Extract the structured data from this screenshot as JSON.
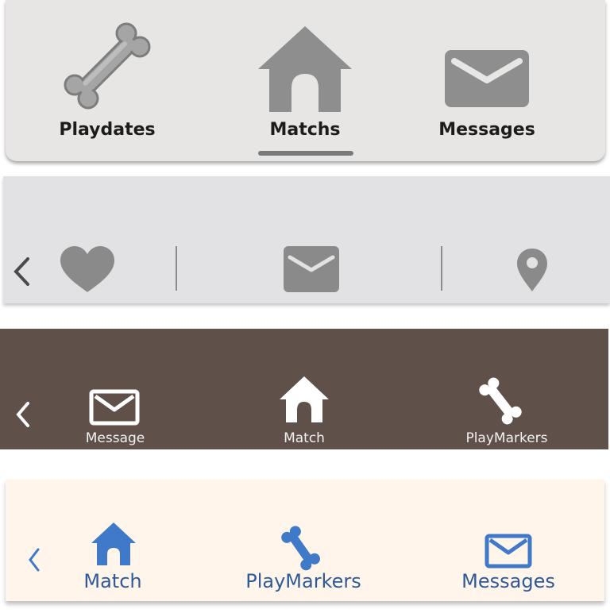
{
  "bar1": {
    "items": [
      {
        "label": "Playdates",
        "icon": "bone-icon"
      },
      {
        "label": "Matchs",
        "icon": "house-icon",
        "active": true
      },
      {
        "label": "Messages",
        "icon": "envelope-icon"
      }
    ],
    "colors": {
      "background": "#e7e6e4",
      "icon": "#8e8e8e",
      "text": "#1c1c1c"
    }
  },
  "bar2": {
    "icons": [
      "chevron-left-icon",
      "heart-icon",
      "envelope-icon",
      "location-pin-icon"
    ],
    "colors": {
      "background": "#e2e1e3",
      "icon": "#8a8a8a"
    }
  },
  "bar3": {
    "items": [
      {
        "label": "Message",
        "icon": "envelope-icon"
      },
      {
        "label": "Match",
        "icon": "house-icon"
      },
      {
        "label": "PlayMarkers",
        "icon": "bone-icon"
      }
    ],
    "colors": {
      "background": "#60504a",
      "icon": "#ffffff",
      "text": "#f2f2f2"
    }
  },
  "bar4": {
    "items": [
      {
        "label": "Match",
        "icon": "house-icon"
      },
      {
        "label": "PlayMarkers",
        "icon": "bone-icon"
      },
      {
        "label": "Messages",
        "icon": "envelope-icon"
      }
    ],
    "colors": {
      "background": "#fff5ea",
      "icon": "#3f79c8",
      "text": "#2f5a99"
    }
  }
}
